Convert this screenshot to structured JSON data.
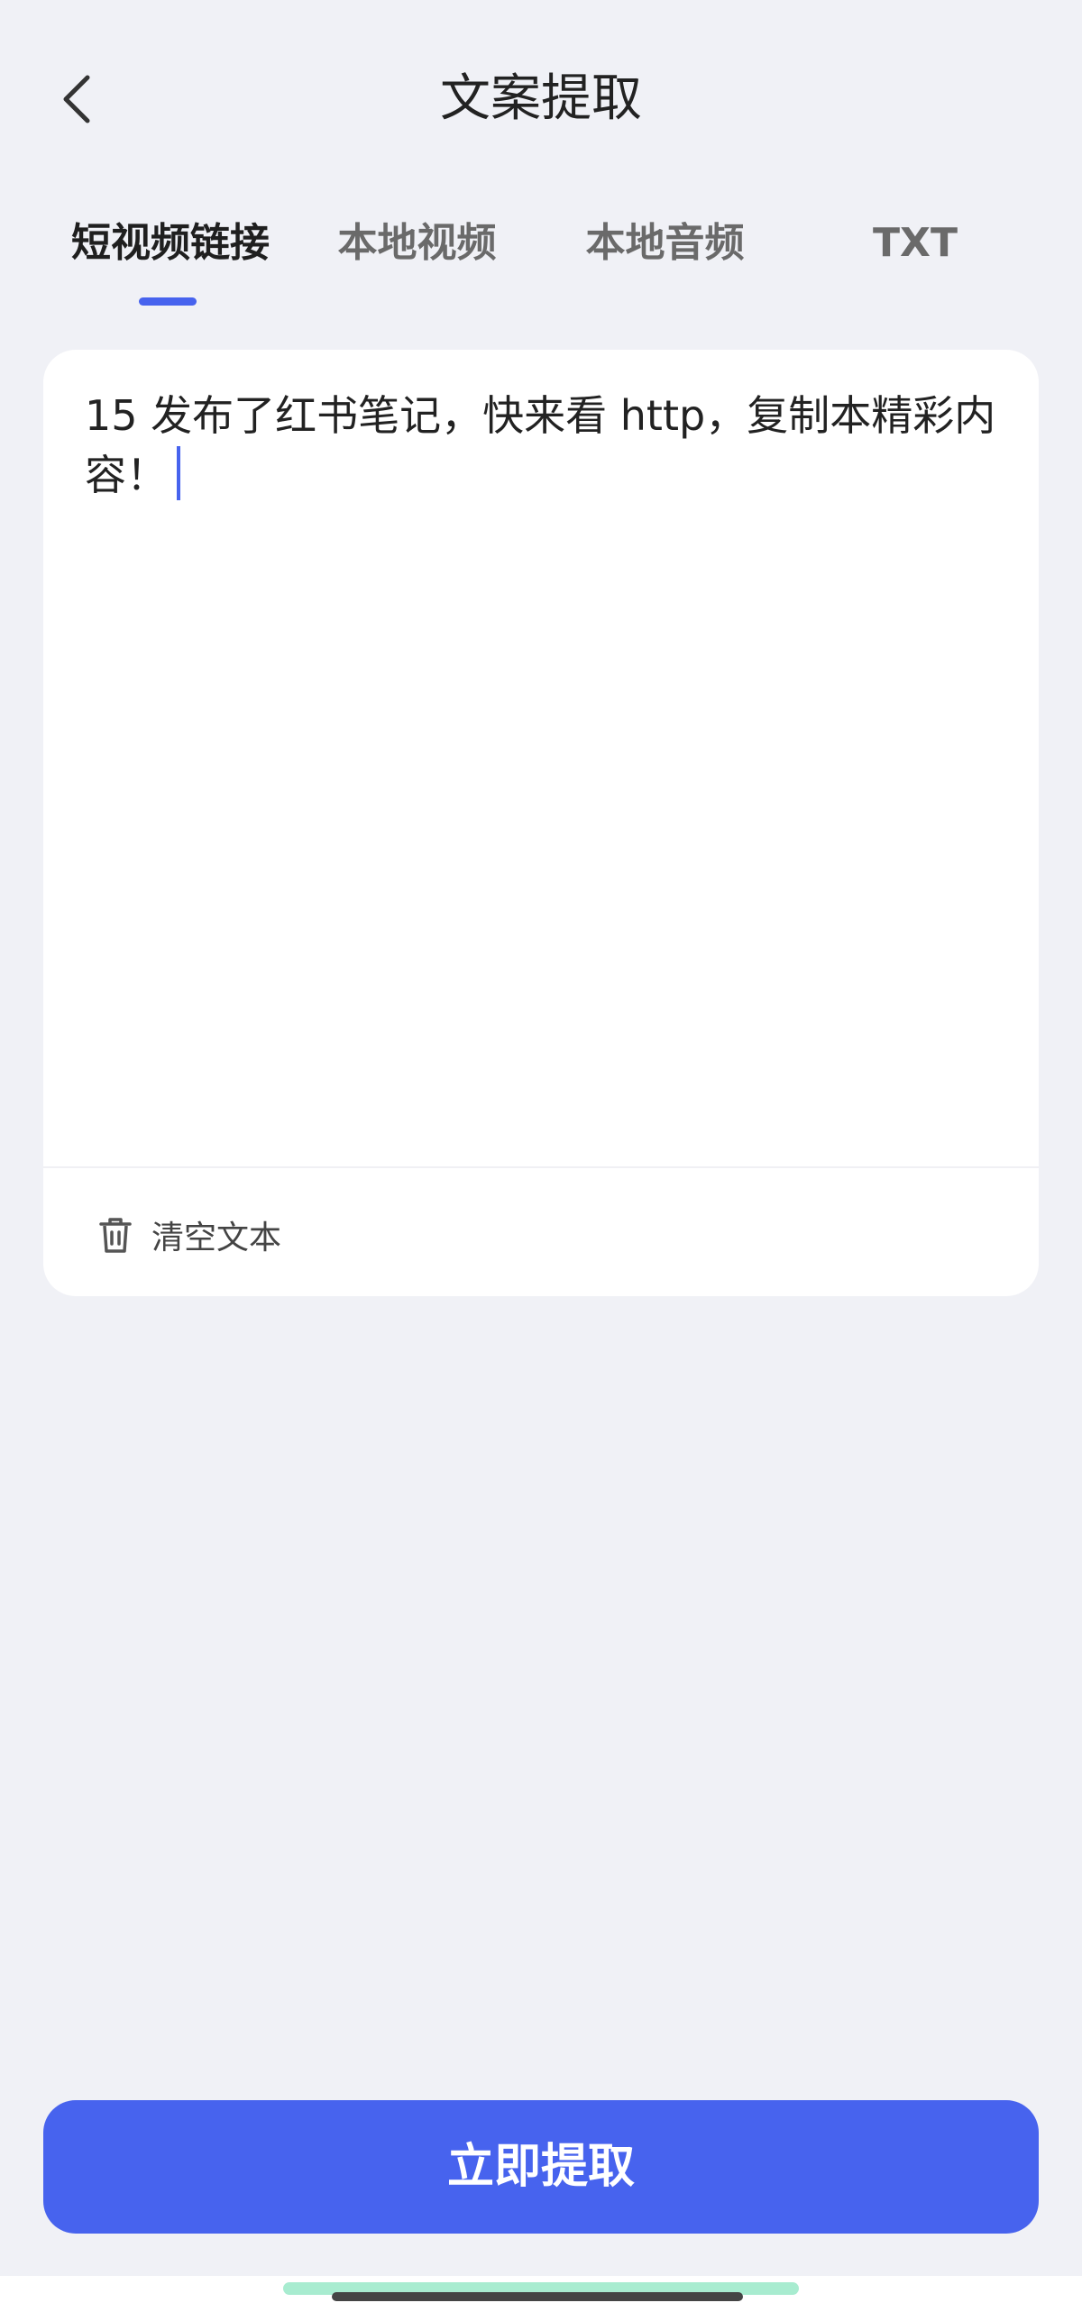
{
  "nav": {
    "back_icon": "chevron-left-icon",
    "title": "文案提取"
  },
  "tabs": [
    {
      "label": "短视频链接",
      "active": true
    },
    {
      "label": "本地视频",
      "active": false
    },
    {
      "label": "本地音频",
      "active": false
    },
    {
      "label": "TXT",
      "active": false
    }
  ],
  "input": {
    "value": "15 ‍‍‍‍‍‍‍发布了‍‍‍红书笔记，快来看‍‍‍‍‍‍‍‍‍‍‍‍ http‍‍‍‍‍‍‍‍‍‍‍‍‍‍‍‍‍‍‍‍‍‍‍‍‍‍‍‍‍‍，复制本‍‍‍‍‍‍‍‍‍‍‍‍‍‍‍‍精彩内容！"
  },
  "clear": {
    "icon": "trash-icon",
    "label": "清空文本"
  },
  "submit": {
    "label": "立即提取"
  },
  "colors": {
    "accent": "#4763ee",
    "background": "#f0f1f6",
    "card": "#ffffff"
  }
}
